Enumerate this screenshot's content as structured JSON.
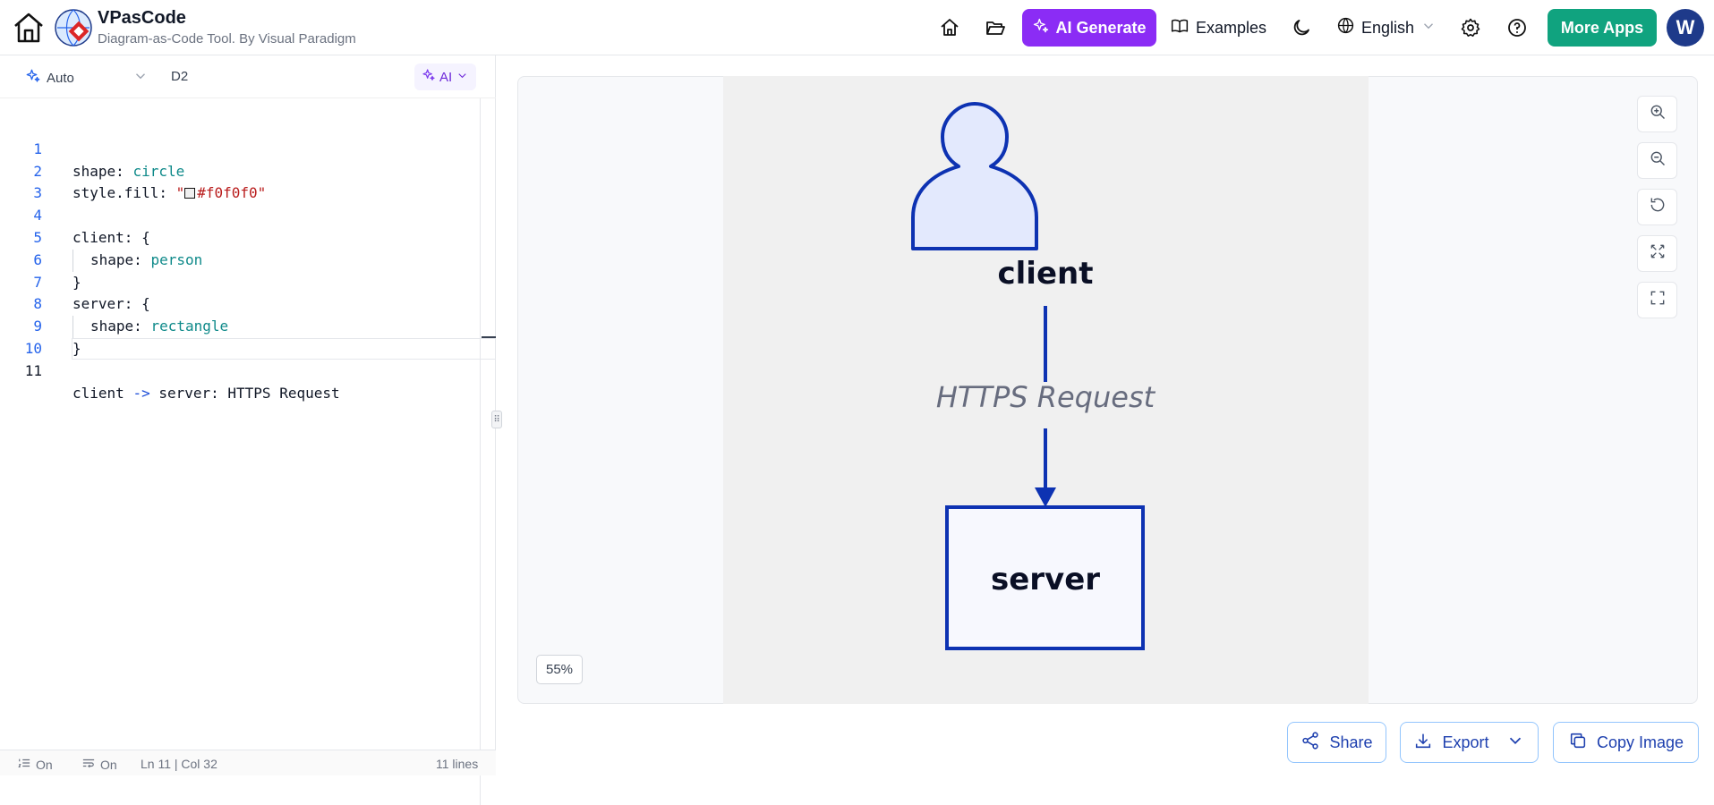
{
  "header": {
    "app_title": "VPasCode",
    "app_subtitle": "Diagram-as-Code Tool. By Visual Paradigm",
    "ai_generate_label": "AI Generate",
    "examples_label": "Examples",
    "language_label": "English",
    "more_apps_label": "More Apps",
    "avatar_initial": "W"
  },
  "editor": {
    "mode_label": "Auto",
    "language_label": "D2",
    "ai_label": "AI",
    "line_numbers": [
      "1",
      "2",
      "3",
      "4",
      "5",
      "6",
      "7",
      "8",
      "9",
      "10",
      "11"
    ],
    "lines": {
      "l1_key": "shape: ",
      "l1_val": "circle",
      "l2_key": "style.fill: ",
      "l2_q1": "\"",
      "l2_val": "#f0f0f0",
      "l2_q2": "\"",
      "l4": "client: {",
      "l5_key": "shape: ",
      "l5_val": "person",
      "l6": "}",
      "l7": "server: {",
      "l8_key": "shape: ",
      "l8_val": "rectangle",
      "l9": "}",
      "l11_a": "client ",
      "l11_op": "->",
      "l11_b": " server: HTTPS Request"
    },
    "status": {
      "line_numbers_toggle": "On",
      "wrap_toggle": "On",
      "cursor_position": "Ln 11 | Col 32",
      "line_count": "11 lines"
    }
  },
  "diagram": {
    "client_label": "client",
    "edge_label": "HTTPS Request",
    "server_label": "server",
    "stroke_color": "#0d32b2",
    "client_fill": "#e3e9fd",
    "server_fill": "#f7f8fe",
    "canvas_fill": "#f0f0f0"
  },
  "preview": {
    "zoom_level": "55%"
  },
  "actions": {
    "share_label": "Share",
    "export_label": "Export",
    "copy_image_label": "Copy Image"
  },
  "colors": {
    "ai_purple": "#8b2cf5",
    "more_apps_green": "#10a37f",
    "avatar_navy": "#1e3a8a"
  },
  "icons": [
    "home-icon",
    "folder-open-icon",
    "sparkles-icon",
    "book-open-icon",
    "moon-icon",
    "globe-icon",
    "chevron-down-icon",
    "gear-icon",
    "help-circle-icon",
    "zoom-in-icon",
    "zoom-out-icon",
    "reset-icon",
    "fit-screen-icon",
    "fullscreen-icon",
    "share-icon",
    "download-icon",
    "copy-icon"
  ]
}
